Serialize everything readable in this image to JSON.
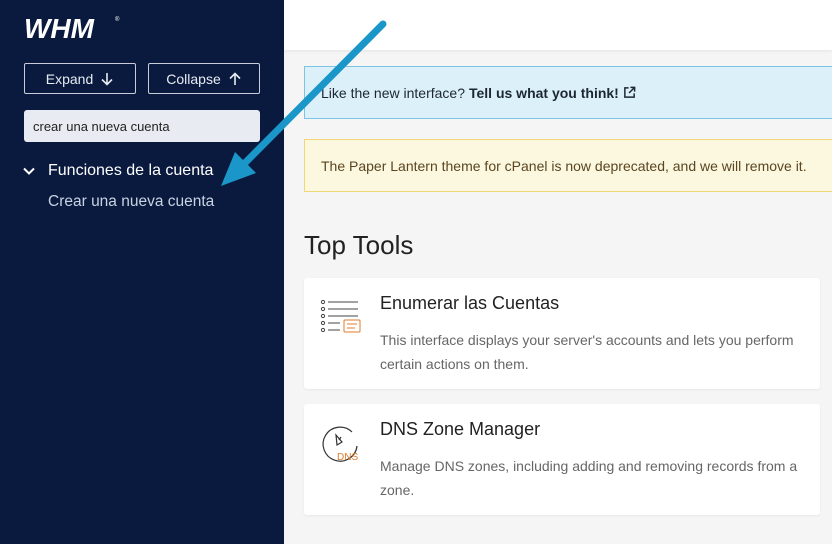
{
  "sidebar": {
    "logo": "WHM",
    "expand_label": "Expand",
    "collapse_label": "Collapse",
    "search_value": "crear una nueva cuenta",
    "section_title": "Funciones de la cuenta",
    "section_item": "Crear una nueva cuenta"
  },
  "alerts": {
    "info_text": "Like the new interface?",
    "info_link": "Tell us what you think!",
    "warning_text": "The Paper Lantern theme for cPanel is now deprecated, and we will remove it."
  },
  "main": {
    "heading": "Top Tools",
    "tools": [
      {
        "title": "Enumerar las Cuentas",
        "description": "This interface displays your server's accounts and lets you perform certain actions on them."
      },
      {
        "title": "DNS Zone Manager",
        "description": "Manage DNS zones, including adding and removing records from a zone.",
        "icon_label": "DNS"
      }
    ]
  },
  "colors": {
    "sidebar_bg": "#091a3e",
    "arrow": "#1a96c8",
    "icon_accent": "#e07b2a"
  }
}
